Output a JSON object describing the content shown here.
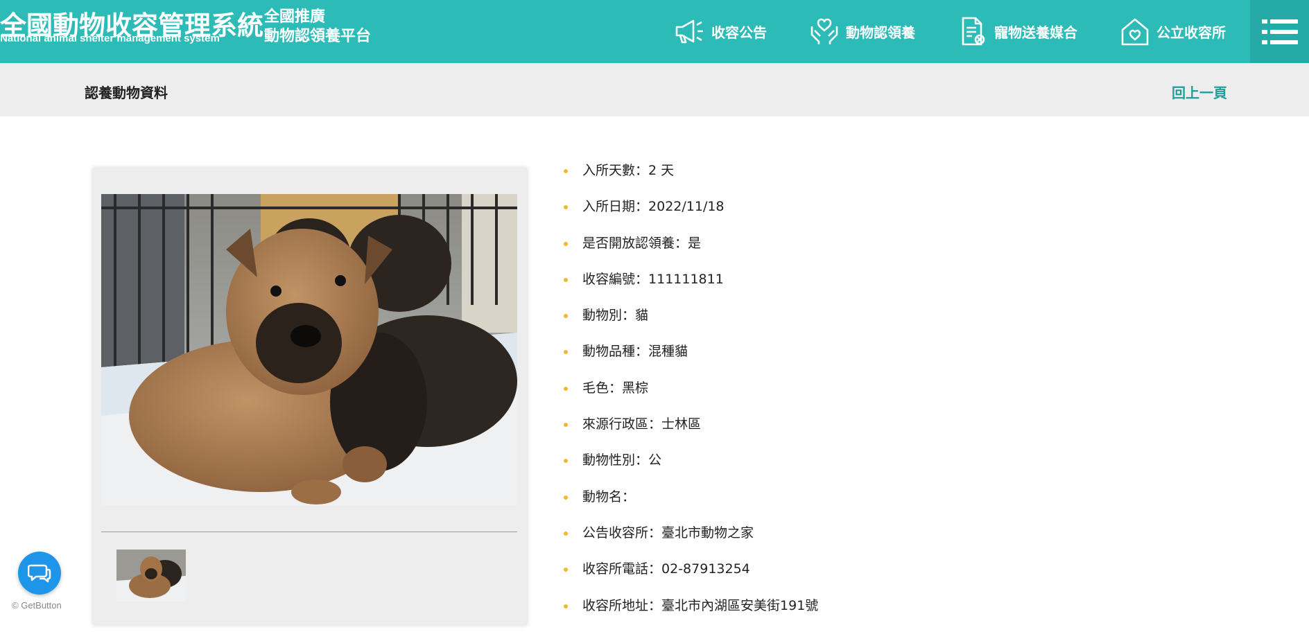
{
  "header": {
    "brand_title": "全國動物收容管理系統",
    "brand_subtitle": "National animal shelter management system",
    "slogan_line1": "全國推廣",
    "slogan_line2": "動物認領養平台",
    "nav": [
      {
        "label": "收容公告",
        "icon": "megaphone-icon"
      },
      {
        "label": "動物認領養",
        "icon": "hands-heart-icon"
      },
      {
        "label": "寵物送養媒合",
        "icon": "document-icon"
      },
      {
        "label": "公立收容所",
        "icon": "house-heart-icon"
      }
    ],
    "menu_icon": "hamburger-menu-icon"
  },
  "breadcrumb": {
    "title": "認養動物資料",
    "back_label": "回上一頁"
  },
  "gallery": {
    "main_photo": "puppies-photo",
    "thumbnail": "puppies-thumbnail"
  },
  "info": [
    {
      "label": "入所天數：",
      "value": "2 天"
    },
    {
      "label": "入所日期：",
      "value": "2022/11/18"
    },
    {
      "label": "是否開放認領養：",
      "value": "是"
    },
    {
      "label": "收容編號：",
      "value": "111111811"
    },
    {
      "label": "動物別：",
      "value": "貓"
    },
    {
      "label": "動物品種：",
      "value": "混種貓"
    },
    {
      "label": "毛色：",
      "value": "黑棕"
    },
    {
      "label": "來源行政區：",
      "value": "士林區"
    },
    {
      "label": "動物性別：",
      "value": "公"
    },
    {
      "label": "動物名：",
      "value": ""
    },
    {
      "label": "公告收容所：",
      "value": "臺北市動物之家"
    },
    {
      "label": "收容所電話：",
      "value": "02-87913254"
    },
    {
      "label": "收容所地址：",
      "value": "臺北市內湖區安美街191號"
    }
  ],
  "chat_widget": {
    "icon": "chat-bubbles-icon",
    "brand": "GetButton"
  },
  "colors": {
    "header_bg": "#2dbbb8",
    "accent_link": "#1f9e99",
    "bullet": "#f5b82e",
    "chat": "#1e95e8"
  }
}
